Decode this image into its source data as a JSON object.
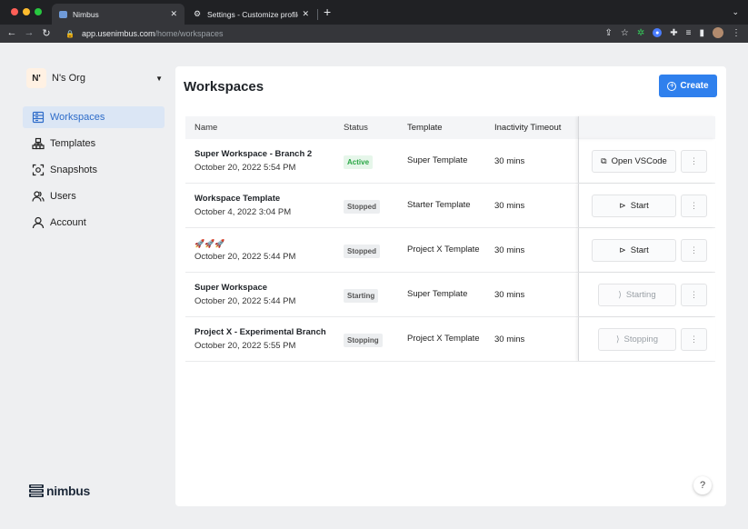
{
  "browser": {
    "tabs": [
      {
        "title": "Nimbus",
        "active": true
      },
      {
        "title": "Settings - Customize profile",
        "active": false
      }
    ],
    "url_host": "app.usenimbus.com",
    "url_path": "/home/workspaces"
  },
  "sidebar": {
    "org_badge": "N'",
    "org_name": "N's Org",
    "items": [
      {
        "label": "Workspaces",
        "icon": "workspaces-icon",
        "active": true
      },
      {
        "label": "Templates",
        "icon": "templates-icon",
        "active": false
      },
      {
        "label": "Snapshots",
        "icon": "snapshots-icon",
        "active": false
      },
      {
        "label": "Users",
        "icon": "users-icon",
        "active": false
      },
      {
        "label": "Account",
        "icon": "account-icon",
        "active": false
      }
    ],
    "brand": "nimbus"
  },
  "main": {
    "title": "Workspaces",
    "create_label": "Create",
    "columns": [
      "Name",
      "Status",
      "Template",
      "Inactivity Timeout"
    ],
    "rows": [
      {
        "name": "Super Workspace - Branch 2",
        "date": "October 20, 2022 5:54 PM",
        "status": "Active",
        "template": "Super Template",
        "timeout": "30 mins",
        "action": "Open VSCode"
      },
      {
        "name": "Workspace Template",
        "date": "October 4, 2022 3:04 PM",
        "status": "Stopped",
        "template": "Starter Template",
        "timeout": "30 mins",
        "action": "Start"
      },
      {
        "name": "🚀🚀🚀",
        "date": "October 20, 2022 5:44 PM",
        "status": "Stopped",
        "template": "Project X Template",
        "timeout": "30 mins",
        "action": "Start"
      },
      {
        "name": "Super Workspace",
        "date": "October 20, 2022 5:44 PM",
        "status": "Starting",
        "template": "Super Template",
        "timeout": "30 mins",
        "action": "Starting"
      },
      {
        "name": "Project X - Experimental Branch",
        "date": "October 20, 2022 5:55 PM",
        "status": "Stopping",
        "template": "Project X Template",
        "timeout": "30 mins",
        "action": "Stopping"
      }
    ],
    "help_label": "?"
  },
  "colors": {
    "accent": "#2f80ed",
    "active_nav_bg": "#dbe6f5",
    "active_badge": "#29a745"
  }
}
